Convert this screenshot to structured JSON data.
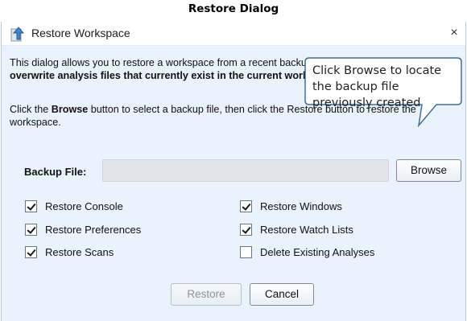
{
  "figure": {
    "title": "Restore Dialog"
  },
  "window": {
    "title": "Restore Workspace",
    "close_glyph": "×"
  },
  "intro": {
    "text": "This dialog allows you to restore a workspace from a recent backup. ",
    "warning_bold": "Warning: this utility will overwrite analysis files that currently exist in the current workspace",
    "tail": "."
  },
  "instructions": {
    "pre": "Click the ",
    "browse_bold": "Browse",
    "post": " button to select a backup file, then click the Restore button to restore the workspace."
  },
  "backup": {
    "label": "Backup File:",
    "value": "",
    "browse_label": "Browse"
  },
  "options": [
    {
      "label": "Restore Console",
      "checked": true
    },
    {
      "label": "Restore Windows",
      "checked": true
    },
    {
      "label": "Restore Preferences",
      "checked": true
    },
    {
      "label": "Restore Watch Lists",
      "checked": true
    },
    {
      "label": "Restore Scans",
      "checked": true
    },
    {
      "label": "Delete Existing Analyses",
      "checked": false
    }
  ],
  "buttons": {
    "restore_label": "Restore",
    "restore_enabled": false,
    "cancel_label": "Cancel"
  },
  "callout": {
    "text": "Click Browse to locate the backup file previously created"
  },
  "icons": {
    "app": "restore-arrow-icon",
    "close": "close-icon",
    "checkbox": "checkbox-icon"
  },
  "colors": {
    "dialog_bg": "#eaf2fb",
    "input_bg": "#e1e4e8",
    "callout_border": "#3f6f9f"
  }
}
